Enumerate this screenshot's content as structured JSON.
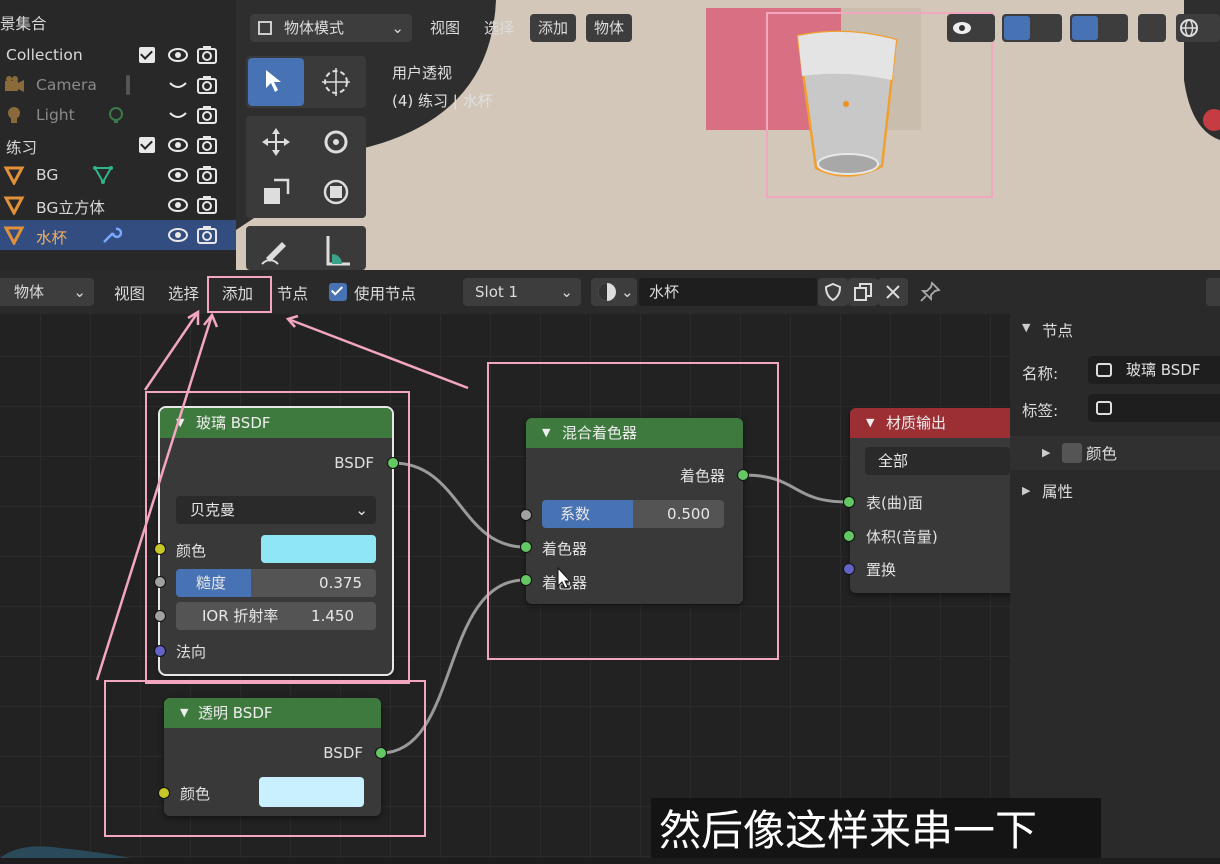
{
  "outliner": {
    "title": "景集合",
    "rows": [
      {
        "label": "Collection"
      },
      {
        "label": "Camera"
      },
      {
        "label": "Light"
      },
      {
        "label": "练习"
      },
      {
        "label": "BG"
      },
      {
        "label": "BG立方体"
      },
      {
        "label": "水杯"
      }
    ]
  },
  "viewport": {
    "mode": "物体模式",
    "menu": [
      "视图",
      "选择",
      "添加",
      "物体"
    ],
    "overlay_line1": "用户透视",
    "overlay_line2": "(4) 练习 | 水杯"
  },
  "node_header": {
    "type": "物体",
    "menu": [
      "视图",
      "选择",
      "添加",
      "节点"
    ],
    "use_nodes_label": "使用节点",
    "slot": "Slot 1",
    "material": "水杯"
  },
  "nodes": {
    "glass": {
      "title": "玻璃 BSDF",
      "output": "BSDF",
      "distribution": "贝克曼",
      "color_label": "颜色",
      "roughness_label": "糙度",
      "roughness_value": "0.375",
      "roughness_fraction": 0.375,
      "ior_label": "IOR 折射率",
      "ior_value": "1.450",
      "normal_label": "法向",
      "color": "#8fe6f5"
    },
    "transparent": {
      "title": "透明 BSDF",
      "output": "BSDF",
      "color_label": "颜色",
      "color": "#c8f0ff"
    },
    "mix": {
      "title": "混合着色器",
      "output": "着色器",
      "factor_label": "系数",
      "factor_value": "0.500",
      "factor_fraction": 0.5,
      "input1": "着色器",
      "input2": "着色器"
    },
    "output": {
      "title": "材质输出",
      "target": "全部",
      "surface": "表(曲)面",
      "volume": "体积(音量)",
      "displacement": "置换"
    }
  },
  "properties": {
    "section": "节点",
    "name_label": "名称:",
    "name_value": "玻璃 BSDF",
    "tag_label": "标签:",
    "color_label": "颜色",
    "attr_label": "属性"
  },
  "caption": "然后像这样来串一下",
  "colors": {
    "annotation": "#f3a6c0",
    "selection": "#334d80",
    "shader_header": "#3e7a3e",
    "output_header": "#9b2f33"
  }
}
